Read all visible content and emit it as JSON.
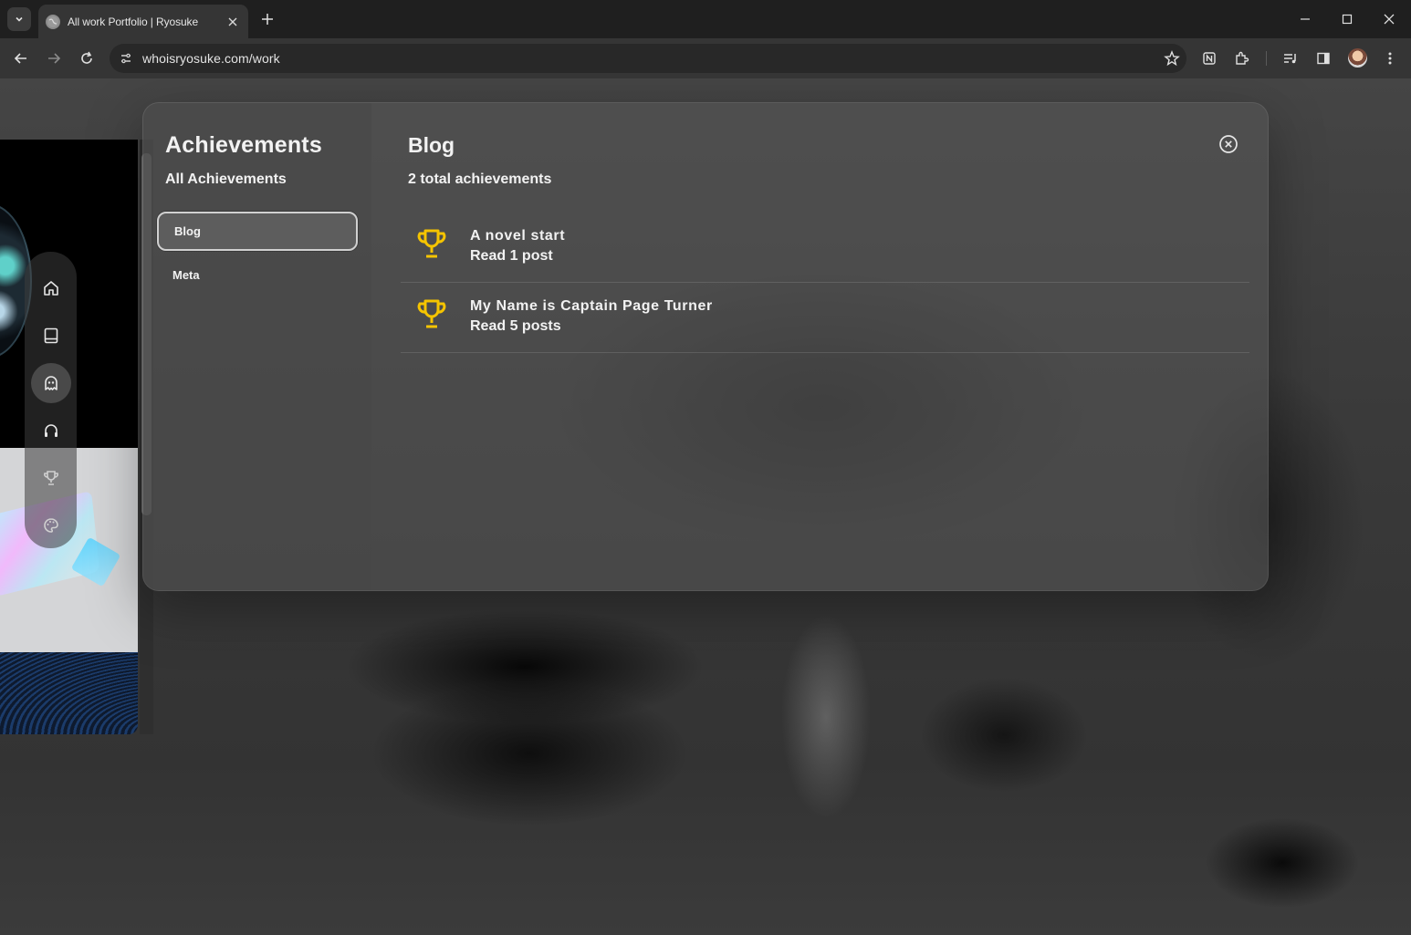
{
  "browser": {
    "tab_title": "All work Portfolio | Ryosuke",
    "url": "whoisryosuke.com/work"
  },
  "achievements_modal": {
    "title": "Achievements",
    "subtitle": "All Achievements",
    "categories": [
      {
        "label": "Blog",
        "active": true
      },
      {
        "label": "Meta",
        "active": false
      }
    ],
    "content": {
      "title": "Blog",
      "count_label": "2 total achievements",
      "items": [
        {
          "name": "A novel start",
          "description": "Read 1 post"
        },
        {
          "name": "My Name is Captain Page Turner",
          "description": "Read 5 posts"
        }
      ]
    }
  },
  "icons": {
    "trophy_color": "#f5c400",
    "dock": [
      "home-icon",
      "book-icon",
      "ghost-icon",
      "headphones-icon",
      "trophy-icon",
      "palette-icon"
    ]
  }
}
